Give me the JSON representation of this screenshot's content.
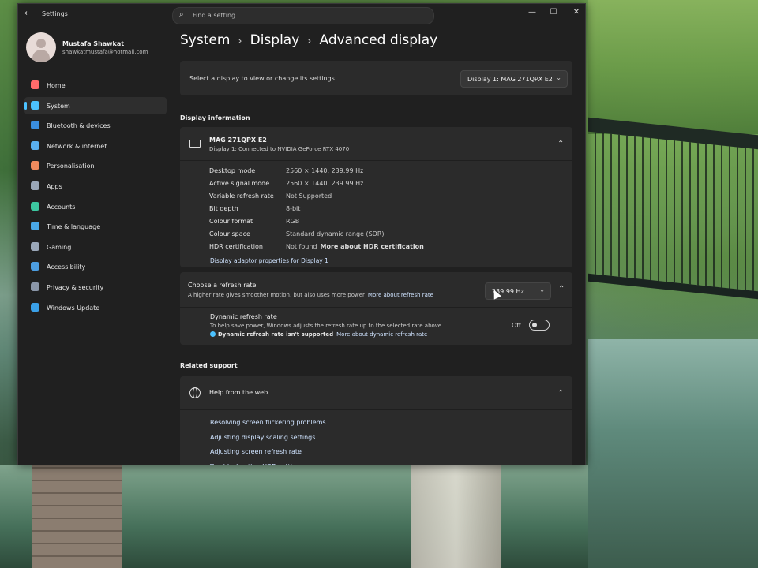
{
  "app": {
    "title": "Settings",
    "back_icon": "back-arrow-icon",
    "window_controls": {
      "minimize": "—",
      "maximize": "☐",
      "close": "✕"
    }
  },
  "search": {
    "placeholder": "Find a setting"
  },
  "profile": {
    "name": "Mustafa Shawkat",
    "email": "shawkatmustafa@hotmail.com"
  },
  "sidebar": {
    "items": [
      {
        "label": "Home",
        "icon": "home-icon",
        "color": "#ff6b6b",
        "active": false
      },
      {
        "label": "System",
        "icon": "system-icon",
        "color": "#4cc2ff",
        "active": true
      },
      {
        "label": "Bluetooth & devices",
        "icon": "bluetooth-icon",
        "color": "#3a8dde",
        "active": false
      },
      {
        "label": "Network & internet",
        "icon": "network-icon",
        "color": "#5ab0f0",
        "active": false
      },
      {
        "label": "Personalisation",
        "icon": "brush-icon",
        "color": "#f08a5d",
        "active": false
      },
      {
        "label": "Apps",
        "icon": "apps-icon",
        "color": "#9aa7b8",
        "active": false
      },
      {
        "label": "Accounts",
        "icon": "accounts-icon",
        "color": "#3cc7a0",
        "active": false
      },
      {
        "label": "Time & language",
        "icon": "globe-clock-icon",
        "color": "#4aa8e8",
        "active": false
      },
      {
        "label": "Gaming",
        "icon": "gamepad-icon",
        "color": "#9aa7b8",
        "active": false
      },
      {
        "label": "Accessibility",
        "icon": "accessibility-icon",
        "color": "#4c9de0",
        "active": false
      },
      {
        "label": "Privacy & security",
        "icon": "shield-icon",
        "color": "#8a96a8",
        "active": false
      },
      {
        "label": "Windows Update",
        "icon": "update-icon",
        "color": "#3aa0e8",
        "active": false
      }
    ]
  },
  "breadcrumb": {
    "items": [
      "System",
      "Display",
      "Advanced display"
    ],
    "separator": "›"
  },
  "select_display": {
    "label": "Select a display to view or change its settings",
    "value": "Display 1: MAG 271QPX E2"
  },
  "display_information": {
    "section_title": "Display information",
    "monitor_name": "MAG 271QPX E2",
    "monitor_subtitle": "Display 1: Connected to NVIDIA GeForce RTX 4070",
    "rows": [
      {
        "key": "Desktop mode",
        "value": "2560 × 1440, 239.99 Hz"
      },
      {
        "key": "Active signal mode",
        "value": "2560 × 1440, 239.99 Hz"
      },
      {
        "key": "Variable refresh rate",
        "value": "Not Supported"
      },
      {
        "key": "Bit depth",
        "value": "8-bit"
      },
      {
        "key": "Colour format",
        "value": "RGB"
      },
      {
        "key": "Colour space",
        "value": "Standard dynamic range (SDR)"
      },
      {
        "key": "HDR certification",
        "value": "Not found",
        "link": "More about HDR certification"
      }
    ],
    "adaptor_link": "Display adaptor properties for Display 1"
  },
  "refresh_rate": {
    "title": "Choose a refresh rate",
    "description": "A higher rate gives smoother motion, but also uses more power",
    "more_link": "More about refresh rate",
    "value": "239.99 Hz",
    "dynamic": {
      "title": "Dynamic refresh rate",
      "description": "To help save power, Windows adjusts the refresh rate up to the selected rate above",
      "note": "Dynamic refresh rate isn't supported",
      "note_link": "More about dynamic refresh rate",
      "toggle_label": "Off"
    }
  },
  "related_support": {
    "section_title": "Related support",
    "help_title": "Help from the web",
    "links": [
      "Resolving screen flickering problems",
      "Adjusting display scaling settings",
      "Adjusting screen refresh rate",
      "Troubleshooting HDR settings"
    ]
  }
}
